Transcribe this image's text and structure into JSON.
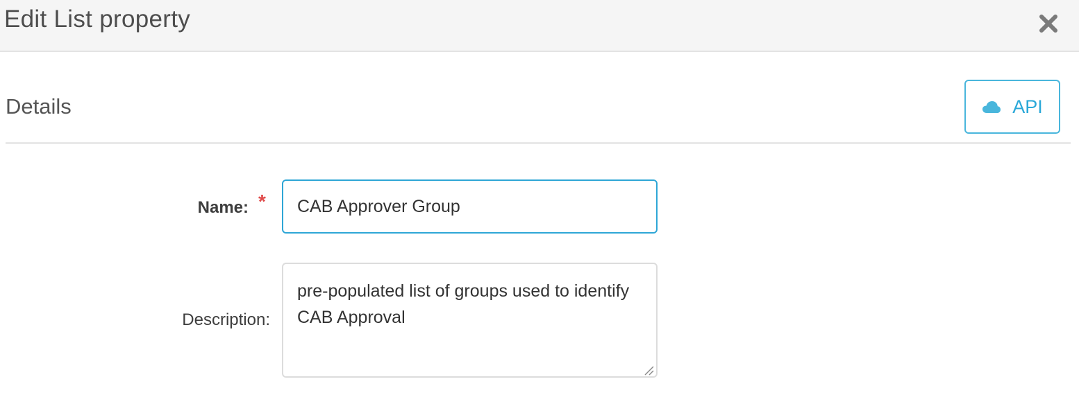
{
  "dialog": {
    "title": "Edit List property",
    "close_icon": "close-icon"
  },
  "details": {
    "section_title": "Details",
    "api_button": {
      "label": "API",
      "icon": "cloud-icon"
    }
  },
  "form": {
    "name": {
      "label": "Name:",
      "required_marker": "*",
      "value": "CAB Approver Group"
    },
    "description": {
      "label": "Description:",
      "value": "pre-populated list of groups used to identify CAB Approval"
    }
  },
  "colors": {
    "accent": "#2ea6d6",
    "required": "#e04b4b",
    "header_bg": "#f5f5f5"
  }
}
